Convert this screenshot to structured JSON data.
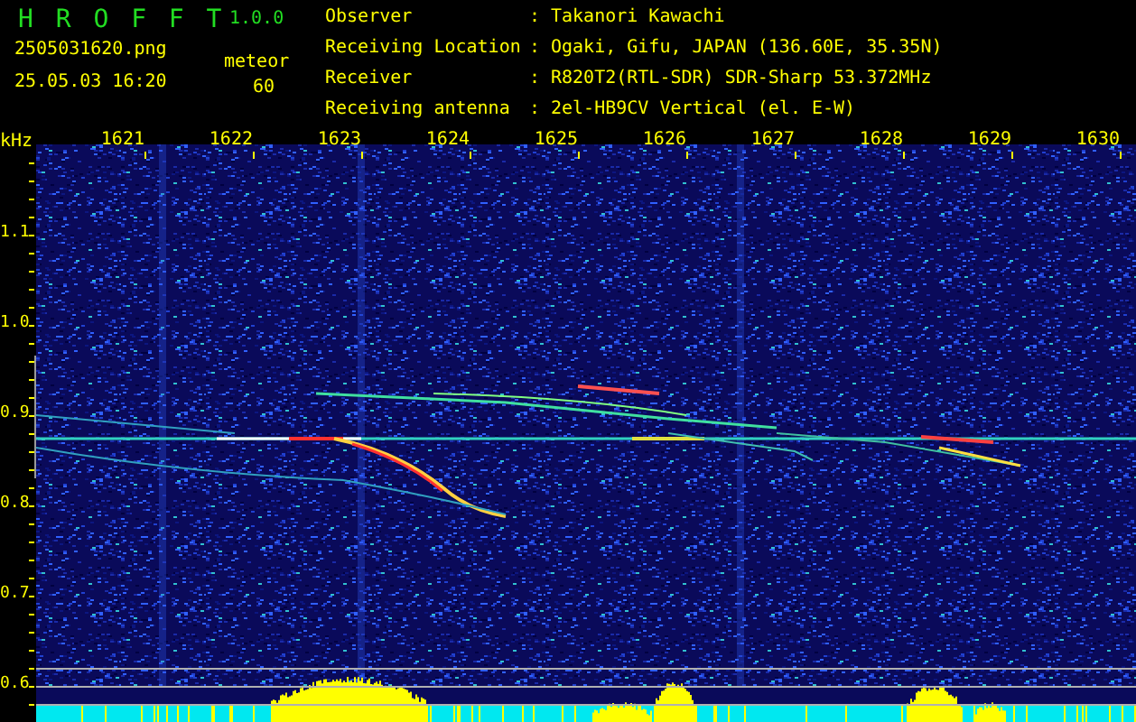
{
  "app": {
    "name": "H R O F F T",
    "version": "1.0.0"
  },
  "file": "2505031620.png",
  "timestamp": "25.05.03 16:20",
  "detection": {
    "label": "meteor",
    "count": "60"
  },
  "station": [
    {
      "label": "Observer",
      "separator": ":",
      "value": "Takanori Kawachi"
    },
    {
      "label": "Receiving Location",
      "separator": ":",
      "value": "Ogaki, Gifu, JAPAN (136.60E, 35.35N)"
    },
    {
      "label": "Receiver",
      "separator": ":",
      "value": "R820T2(RTL-SDR) SDR-Sharp 53.372MHz"
    },
    {
      "label": "Receiving antenna",
      "separator": ":",
      "value": "2el-HB9CV Vertical (el. E-W)"
    }
  ],
  "spectrogram": {
    "unit": "kHz",
    "x_labels": [
      "1621",
      "1622",
      "1623",
      "1624",
      "1625",
      "1626",
      "1627",
      "1628",
      "1629",
      "1630"
    ],
    "y_labels": [
      "1.1",
      "1.0",
      "0.9",
      "0.8",
      "0.7",
      "0.6"
    ]
  }
}
